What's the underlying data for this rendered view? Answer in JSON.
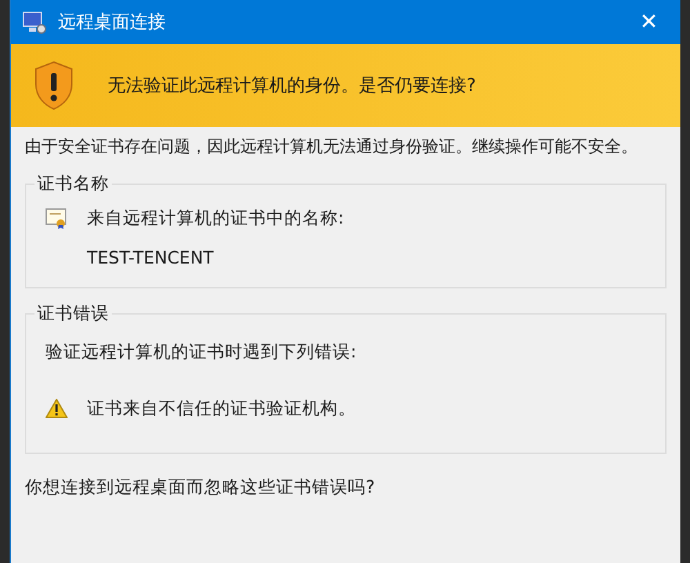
{
  "window": {
    "title": "远程桌面连接",
    "close": "✕"
  },
  "banner": {
    "message": "无法验证此远程计算机的身份。是否仍要连接?"
  },
  "intro": "由于安全证书存在问题，因此远程计算机无法通过身份验证。继续操作可能不安全。",
  "groups": [
    {
      "title": "证书名称",
      "lines": [
        {
          "kind": "certificate",
          "text": "来自远程计算机的证书中的名称:"
        },
        {
          "kind": "plain",
          "text": "TEST-TENCENT"
        }
      ]
    },
    {
      "title": "证书错误",
      "lines": [
        {
          "kind": "header",
          "text": "验证远程计算机的证书时遇到下列错误:"
        },
        {
          "kind": "warning",
          "text": "证书来自不信任的证书验证机构。"
        }
      ]
    }
  ],
  "question": "你想连接到远程桌面而忽略这些证书错误吗?"
}
